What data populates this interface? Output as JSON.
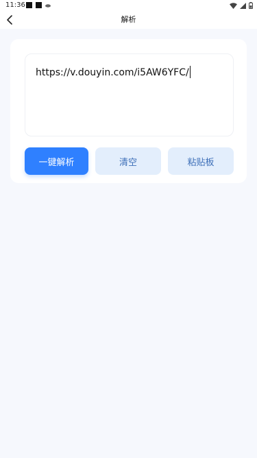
{
  "status_bar": {
    "time": "11:36"
  },
  "header": {
    "title": "解析"
  },
  "input": {
    "value": "https://v.douyin.com/i5AW6YFC/"
  },
  "buttons": {
    "parse": "一键解析",
    "clear": "清空",
    "paste": "粘贴板"
  },
  "colors": {
    "accent": "#2f80ff",
    "secondary_bg": "#e3eefc",
    "secondary_text": "#3d6fb8",
    "page_bg": "#f6f8fd"
  },
  "icons": {
    "back": "chevron-left-icon",
    "wifi": "wifi-icon",
    "signal": "signal-icon",
    "battery": "battery-icon"
  }
}
